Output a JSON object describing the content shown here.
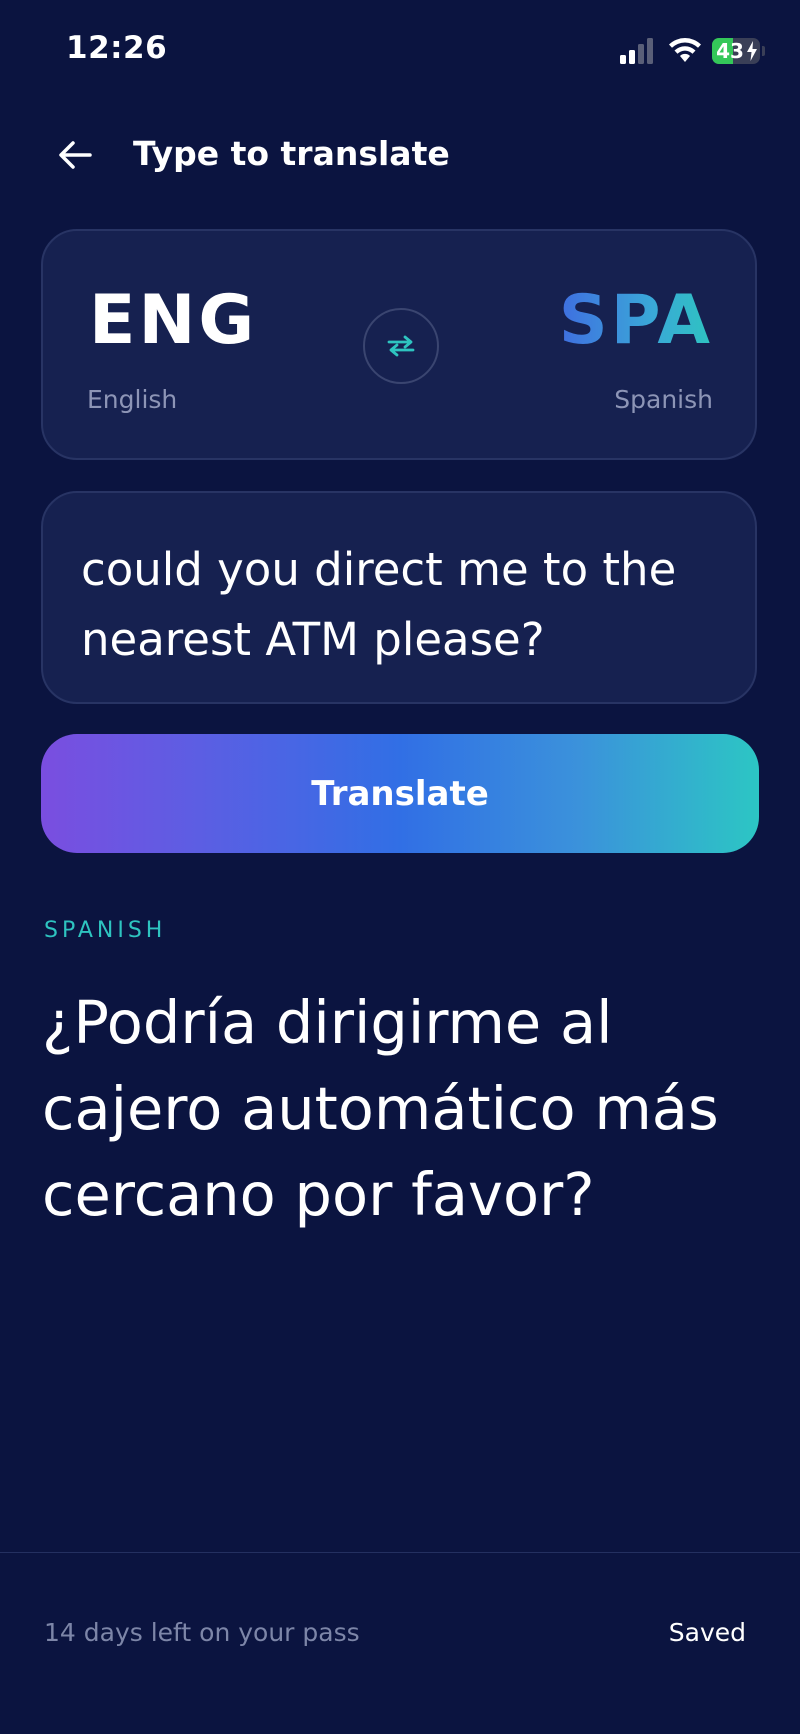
{
  "status_bar": {
    "time": "12:26",
    "battery_level": "43",
    "battery_fill_fraction": 0.43,
    "battery_color": "#34c759",
    "icons": [
      "cellular-signal-icon",
      "wifi-icon",
      "battery-icon",
      "charging-bolt-icon"
    ]
  },
  "header": {
    "back_icon": "arrow-left-icon",
    "title": "Type to translate"
  },
  "languages": {
    "source": {
      "code": "ENG",
      "name": "English"
    },
    "target": {
      "code": "SPA",
      "name": "Spanish"
    },
    "swap_icon": "swap-arrows-icon"
  },
  "input": {
    "text": "could you direct me to the nearest ATM please?"
  },
  "translate_button": {
    "label": "Translate"
  },
  "result": {
    "language_label": "SPANISH",
    "text": "¿Podría dirigirme al cajero automático más cercano por favor?"
  },
  "footer": {
    "pass_text": "14 days left on your pass",
    "saved_label": "Saved"
  },
  "colors": {
    "background": "#0b1440",
    "card": "#162150",
    "accent_teal": "#2ec4c0",
    "accent_purple": "#7a4ee0",
    "accent_blue": "#316fe5"
  }
}
